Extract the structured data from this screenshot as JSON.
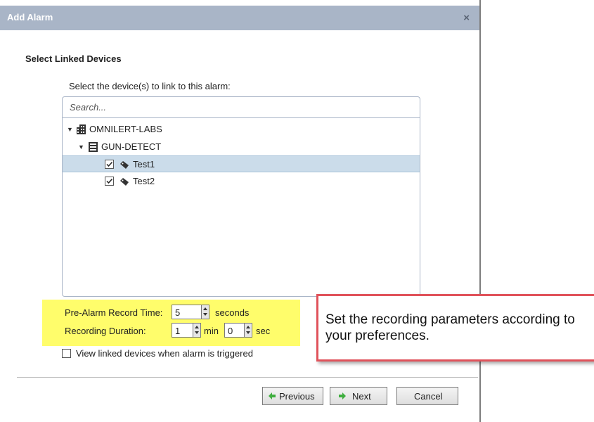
{
  "dialog": {
    "title": "Add Alarm",
    "close_glyph": "×",
    "section_title": "Select Linked Devices",
    "prompt": "Select the device(s) to link to this alarm:"
  },
  "search": {
    "placeholder": "Search..."
  },
  "tree": {
    "site": {
      "label": "OMNILERT-LABS",
      "icon": "building-icon"
    },
    "group": {
      "label": "GUN-DETECT",
      "icon": "server-icon"
    },
    "devices": [
      {
        "label": "Test1",
        "checked": true,
        "selected": true,
        "icon": "tag-icon"
      },
      {
        "label": "Test2",
        "checked": true,
        "selected": false,
        "icon": "tag-icon"
      }
    ]
  },
  "params": {
    "pre_alarm_label": "Pre-Alarm Record Time:",
    "pre_alarm_value": "5",
    "pre_alarm_unit": "seconds",
    "duration_label": "Recording Duration:",
    "duration_min_value": "1",
    "duration_min_unit": "min",
    "duration_sec_value": "0",
    "duration_sec_unit": "sec"
  },
  "view_linked": {
    "label": "View linked devices when alarm is triggered",
    "checked": false
  },
  "buttons": {
    "previous": "Previous",
    "next": "Next",
    "cancel": "Cancel"
  },
  "callout": {
    "text": "Set the recording parameters according to your preferences."
  },
  "colors": {
    "titlebar": "#a9b5c7",
    "selection": "#cbdcea",
    "highlight": "#fffd6b",
    "callout_border": "#e0525a",
    "nav_arrow": "#3fae3f"
  }
}
